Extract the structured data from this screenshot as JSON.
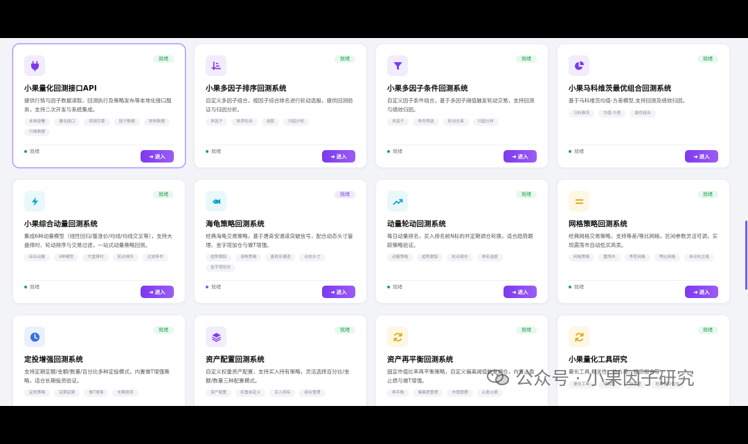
{
  "cards": [
    {
      "title": "小果量化回测接口API",
      "desc": "提供行情与因子数据读取、回测执行及策略发布等本地化接口服务，支持二次开发与系统集成。",
      "tags": [
        "本地部署",
        "量化接口",
        "回测引擎",
        "因子数据",
        "财务数据",
        "行情数据"
      ],
      "status": "就绪",
      "status_style": "green",
      "footer": "就绪",
      "icon": "plug-icon",
      "icon_bg": "#f1ecfe",
      "icon_color": "#7c3aed",
      "dot": "#22a052",
      "active": true
    },
    {
      "title": "小果多因子排序回测系统",
      "desc": "自定义多因子组合，按因子综合排名进行轮动选股，提供回测验证与归因分析。",
      "tags": [
        "多因子",
        "排序轮动",
        "选股",
        "归因分析"
      ],
      "status": "就绪",
      "status_style": "green",
      "footer": "就绪",
      "icon": "sort-icon",
      "icon_bg": "#f1ecfe",
      "icon_color": "#7c3aed",
      "dot": "#22a052"
    },
    {
      "title": "小果多因子条件回测系统",
      "desc": "自定义因子条件组合，基于多因子阈值触发轮动交易，支持回测与绩效归因。",
      "tags": [
        "多因子",
        "条件筛选",
        "轮动交易",
        "归因分析"
      ],
      "status": "就绪",
      "status_style": "green",
      "footer": "就绪",
      "icon": "filter-icon",
      "icon_bg": "#f1ecfe",
      "icon_color": "#7c3aed",
      "dot": "#22a052"
    },
    {
      "title": "小果马科维茨最优组合回测系统",
      "desc": "基于马科维茨均值-方差模型,支持回测及绩效归因。",
      "tags": [
        "马科维茨",
        "均值-方差",
        "最优组合"
      ],
      "status": "就绪",
      "status_style": "green",
      "footer": "就绪",
      "icon": "pie-icon",
      "icon_bg": "#f1ecfe",
      "icon_color": "#7c3aed",
      "dot": "#22a052"
    },
    {
      "title": "小果综合动量回测系统",
      "desc": "集成6种动量模型（线性回归/基准价/均线/均线交叉等），支持大盘择时、轮动排序与交易过滤，一站式动量策略回测。",
      "tags": [
        "综合动量",
        "6种模型",
        "大盘择时",
        "轮动排序",
        "过滤条件"
      ],
      "status": "就绪",
      "status_style": "green",
      "footer": "就绪",
      "icon": "bolt-icon",
      "icon_bg": "#e8f8fb",
      "icon_color": "#0ea5c6",
      "dot": "#22a052"
    },
    {
      "title": "海龟策略回测系统",
      "desc": "经典海龟交易策略，基于唐奇安通道突破信号，配合动态头寸管理、金字塔加仓与做T增强。",
      "tags": [
        "趋势跟踪",
        "海龟策略",
        "唐奇安通道",
        "动态头寸",
        "金字塔加仓"
      ],
      "status": "就绪",
      "status_style": "purple",
      "footer": "就绪",
      "icon": "fish-icon",
      "icon_bg": "#e8f8fb",
      "icon_color": "#0ea5c6",
      "dot": "#6b5fd6"
    },
    {
      "title": "动量轮动回测系统",
      "desc": "每日动量排名，买入排名前N标的并定期调仓轮换，适合趋势跟踪策略验证。",
      "tags": [
        "动量策略",
        "趋势跟踪",
        "轮动调仓",
        "排名选股"
      ],
      "status": "就绪",
      "status_style": "green",
      "footer": "就绪",
      "icon": "trend-icon",
      "icon_bg": "#e8f8fb",
      "icon_color": "#0ea5c6",
      "dot": "#22a052"
    },
    {
      "title": "网格策略回测系统",
      "desc": "经典网格交易策略，支持等差/等比网格，区间参数灵活可调，实现震荡市自动低买高卖。",
      "tags": [
        "网格策略",
        "震荡市",
        "等差网格",
        "等比网格",
        "自动化交易"
      ],
      "status": "就绪",
      "status_style": "green",
      "footer": "就绪",
      "icon": "equals-icon",
      "icon_bg": "#fdf7e3",
      "icon_color": "#e0a410",
      "dot": "#22a052"
    },
    {
      "title": "定投增强回测系统",
      "desc": "支持定期定额/金额/数量/百分比多种定投模式，内置做T增强策略，适合长期投资验证。",
      "tags": [
        "定投策略",
        "定期定额",
        "做T增强",
        "长期投资"
      ],
      "status": "就绪",
      "status_style": "green",
      "footer": "",
      "icon": "clock-icon",
      "icon_bg": "#eaf0fd",
      "icon_color": "#3b6fe0",
      "dot": "#22a052"
    },
    {
      "title": "资产配置回测系统",
      "desc": "自定义权重资产配置，支持买入持有策略，灵活选择百分比/金额/数量三种配置模式。",
      "tags": [
        "资产配置",
        "权重自定义",
        "买入持有",
        "组合管理"
      ],
      "status": "就绪",
      "status_style": "green",
      "footer": "",
      "icon": "layers-icon",
      "icon_bg": "#f1ecfe",
      "icon_color": "#7c3aed",
      "dot": "#22a052"
    },
    {
      "title": "资产再平衡回测系统",
      "desc": "固定市值比率再平衡策略，自定义偏离阈值触发调仓，内置止盈止损与做T增强。",
      "tags": [
        "再平衡",
        "偏离度管理",
        "市值管理",
        "止盈止损"
      ],
      "status": "就绪",
      "status_style": "green",
      "footer": "",
      "icon": "refresh-icon",
      "icon_bg": "#fdf7e3",
      "icon_color": "#e0a410",
      "dot": "#22a052"
    },
    {
      "title": "小果量化工具研究",
      "desc": "量化工具,相关性、协方差、投资组合等",
      "tags": [
        "量化工具",
        "相关性",
        "协方差",
        "投资组合优化"
      ],
      "status": "就绪",
      "status_style": "green",
      "footer": "",
      "icon": "refresh-icon",
      "icon_bg": "#fdf7e3",
      "icon_color": "#e0a410",
      "dot": "#22a052"
    }
  ],
  "enter_label": "➜ 进入",
  "watermark": {
    "text": "公众号 · 小果因子研究",
    "icon": "wechat-icon"
  }
}
